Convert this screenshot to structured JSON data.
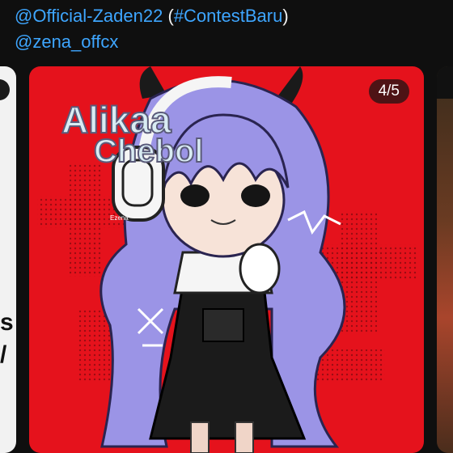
{
  "caption": {
    "mention1": "@Official-Zaden22",
    "open_paren": " (",
    "hashtag": "#ContestBaru",
    "close_paren": ")",
    "mention2": "@zena_offcx"
  },
  "carousel": {
    "counter": "4/5",
    "image": {
      "title_line1": "Alikaa",
      "title_line2": "Chebol",
      "small_text": "Ezena"
    }
  },
  "colors": {
    "link": "#3ea6ff",
    "card_bg": "#e5121c",
    "hair": "#9b94e6"
  },
  "icons": [
    "headphones-icon",
    "horns-icon"
  ]
}
